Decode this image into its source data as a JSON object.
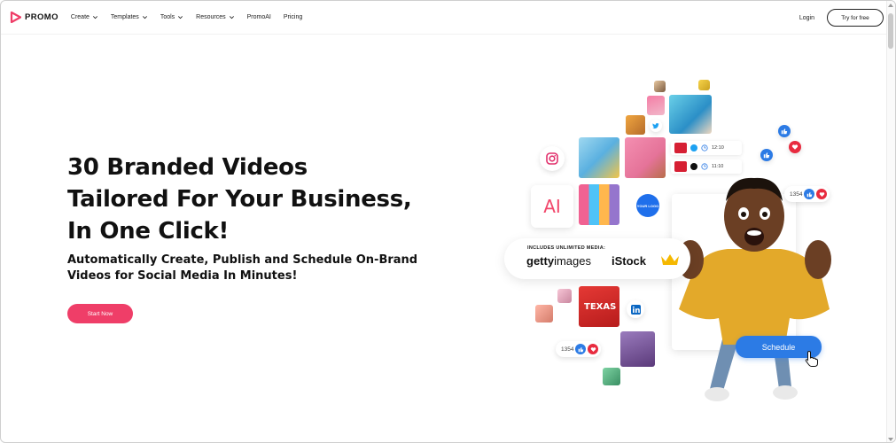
{
  "nav": {
    "logo": "PROMO",
    "items": [
      {
        "label": "Create",
        "dropdown": true
      },
      {
        "label": "Templates",
        "dropdown": true
      },
      {
        "label": "Tools",
        "dropdown": true
      },
      {
        "label": "Resources",
        "dropdown": true
      },
      {
        "label": "PromoAI",
        "dropdown": false
      },
      {
        "label": "Pricing",
        "dropdown": false
      }
    ],
    "login": "Login",
    "try_free": "Try for free"
  },
  "hero": {
    "title_line1": "30 Branded Videos",
    "title_line2": "Tailored For Your Business,",
    "title_line3": "In One Click!",
    "subtitle_line1": "Automatically Create, Publish and Schedule On-Brand",
    "subtitle_line2": "Videos for Social Media In Minutes!",
    "cta": "Start Now"
  },
  "collage": {
    "ai_label": "AI",
    "your_logo": "YOUR LOGO",
    "media_label": "INCLUDES UNLIMITED MEDIA:",
    "getty_bold": "getty",
    "getty_light": "images",
    "istock": "iStock",
    "times": [
      "12:10",
      "11:10"
    ],
    "likes_top": "1354",
    "likes_bottom": "1354",
    "tile_texas": "TEXAS",
    "schedule": "Schedule"
  },
  "colors": {
    "brand_pink": "#ef3e68",
    "schedule_blue": "#2c7be5"
  }
}
